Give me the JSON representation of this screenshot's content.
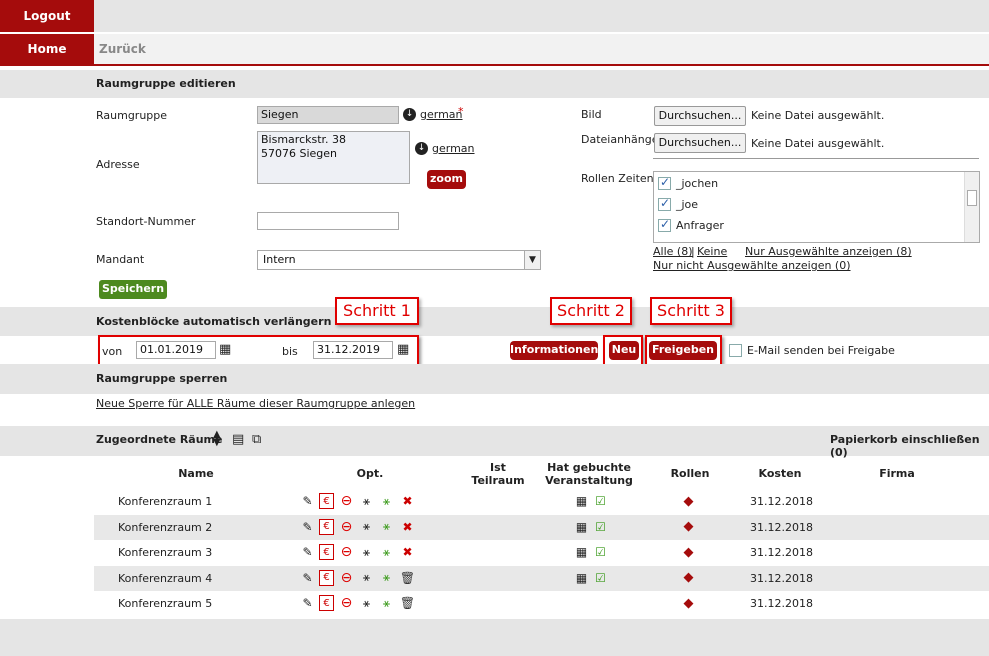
{
  "nav": {
    "logout": "Logout",
    "home": "Home",
    "back": "Zurück"
  },
  "section_edit": {
    "title": "Raumgruppe editieren"
  },
  "form": {
    "raumgruppe_label": "Raumgruppe",
    "raumgruppe_value": "Siegen",
    "lang_link": "german",
    "required": "*",
    "adresse_label": "Adresse",
    "adresse_value": "Bismarckstr. 38\n57076 Siegen",
    "adresse_lang": "german",
    "zoom": "zoom",
    "standort_label": "Standort-Nummer",
    "standort_value": "",
    "mandant_label": "Mandant",
    "mandant_value": "Intern",
    "save": "Speichern",
    "bild_label": "Bild",
    "datei_label": "Dateianhänge",
    "browse": "Durchsuchen...",
    "no_file": "Keine Datei ausgewählt.",
    "rollen_label": "Rollen Zeiten",
    "rollen_items": [
      {
        "label": "_jochen",
        "checked": true
      },
      {
        "label": "_joe",
        "checked": true
      },
      {
        "label": "Anfrager",
        "checked": true
      }
    ],
    "alle": "Alle (8)",
    "sep": "|",
    "keine": "Keine",
    "nur_ausgew": "Nur Ausgewählte anzeigen (8)",
    "nur_nicht": "Nur nicht Ausgewählte anzeigen (0)"
  },
  "kosten": {
    "title": "Kostenblöcke automatisch verlängern",
    "von_label": "von",
    "von_value": "01.01.2019",
    "bis_label": "bis",
    "bis_value": "31.12.2019",
    "informationen": "Informationen",
    "neu": "Neu",
    "freigeben": "Freigeben",
    "email_label": "E-Mail senden bei Freigabe"
  },
  "callouts": {
    "s1": "Schritt 1",
    "s2": "Schritt 2",
    "s3": "Schritt 3"
  },
  "sperren": {
    "title": "Raumgruppe sperren",
    "link": "Neue Sperre für ALLE Räume dieser Raumgruppe anlegen"
  },
  "raeume": {
    "title": "Zugeordnete Räume",
    "papierkorb": "Papierkorb einschließen (0)",
    "headers": {
      "name": "Name",
      "opt": "Opt.",
      "ist1": "Ist",
      "ist2": "Teilraum",
      "hat1": "Hat gebuchte",
      "hat2": "Veranstaltung",
      "rollen": "Rollen",
      "kosten": "Kosten",
      "firma": "Firma"
    },
    "rows": [
      {
        "name": "Konferenzraum 1",
        "date": "31.12.2018",
        "booked": true
      },
      {
        "name": "Konferenzraum 2",
        "date": "31.12.2018",
        "booked": true
      },
      {
        "name": "Konferenzraum 3",
        "date": "31.12.2018",
        "booked": true
      },
      {
        "name": "Konferenzraum 4",
        "date": "31.12.2018",
        "booked": true
      },
      {
        "name": "Konferenzraum 5",
        "date": "31.12.2018",
        "booked": false
      }
    ]
  },
  "colors": {
    "accent": "#a50c0c",
    "green": "#4d8a1f",
    "band": "#e5e5e5",
    "callout": "#e00000"
  },
  "icons": [
    "edit-icon",
    "euro-doc-icon",
    "delete-icon",
    "wand-icon",
    "copy-icon",
    "trash-icon",
    "sort-icon",
    "document-icon",
    "calendar-icon",
    "checkbox-icon",
    "roles-icon"
  ]
}
